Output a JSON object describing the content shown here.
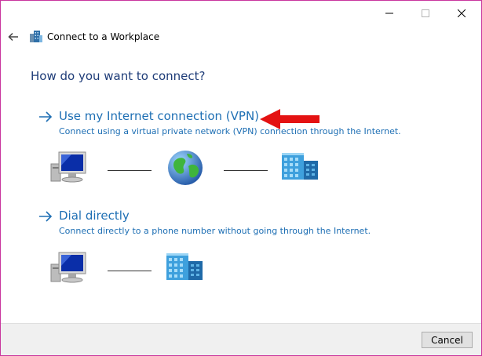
{
  "window": {
    "title": "Connect to a Workplace",
    "controls": {
      "minimize": "minimize-icon",
      "maximize": "maximize-icon",
      "close": "close-icon"
    },
    "frame_color": "#c9369e"
  },
  "nav": {
    "back_icon": "back-arrow-icon",
    "app_icon": "workplace-icon"
  },
  "main": {
    "heading": "How do you want to connect?",
    "options": [
      {
        "title": "Use my Internet connection (VPN)",
        "description": "Connect using a virtual private network (VPN) connection through the Internet.",
        "diagram": [
          "computer-icon",
          "globe-icon",
          "office-building-icon"
        ]
      },
      {
        "title": "Dial directly",
        "description": "Connect directly to a phone number without going through the Internet.",
        "diagram": [
          "computer-icon",
          "office-building-icon"
        ]
      }
    ],
    "annotation_arrow_color": "#e41212",
    "link_color": "#1e6fb4"
  },
  "footer": {
    "cancel_label": "Cancel"
  }
}
